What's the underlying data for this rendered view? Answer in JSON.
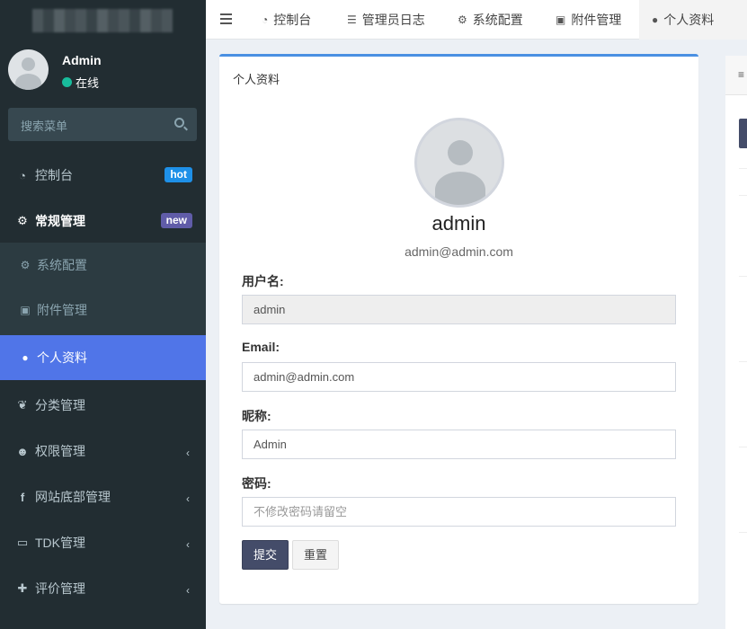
{
  "sidebar": {
    "user": {
      "name": "Admin",
      "status": "在线"
    },
    "search_placeholder": "搜索菜单",
    "items": [
      {
        "label": "控制台",
        "icon": "dashboard-icon",
        "badge": "hot"
      },
      {
        "label": "常规管理",
        "icon": "cogs-icon",
        "badge": "new"
      },
      {
        "label": "分类管理",
        "icon": "leaf-icon"
      },
      {
        "label": "权限管理",
        "icon": "users-icon"
      },
      {
        "label": "网站底部管理",
        "icon": "facebook-icon"
      },
      {
        "label": "TDK管理",
        "icon": "desktop-icon"
      },
      {
        "label": "评价管理",
        "icon": "puzzle-icon"
      }
    ],
    "submenu": [
      {
        "label": "系统配置",
        "icon": "gear-icon"
      },
      {
        "label": "附件管理",
        "icon": "image-icon"
      },
      {
        "label": "个人资料",
        "icon": "user-icon",
        "active": true
      }
    ]
  },
  "topbar": {
    "tabs": [
      {
        "label": "控制台",
        "icon": "dashboard-icon"
      },
      {
        "label": "管理员日志",
        "icon": "list-icon"
      },
      {
        "label": "系统配置",
        "icon": "gear-icon"
      },
      {
        "label": "附件管理",
        "icon": "image-icon"
      },
      {
        "label": "个人资料",
        "icon": "user-icon",
        "active": true
      }
    ]
  },
  "profile": {
    "box_title": "个人资料",
    "name": "admin",
    "email": "admin@admin.com",
    "fields": {
      "username_label": "用户名:",
      "username_value": "admin",
      "email_label": "Email:",
      "email_value": "admin@admin.com",
      "nickname_label": "昵称:",
      "nickname_value": "Admin",
      "password_label": "密码:",
      "password_placeholder": "不修改密码请留空"
    },
    "submit_label": "提交",
    "reset_label": "重置"
  },
  "colors": {
    "sidebar_bg": "#222d32",
    "active_item": "#5075e8",
    "box_accent": "#4a90e2",
    "submit_bg": "#444c69",
    "badge_hot": "#1e90e8",
    "badge_new": "#605ca8",
    "online_dot": "#18bc9c"
  }
}
